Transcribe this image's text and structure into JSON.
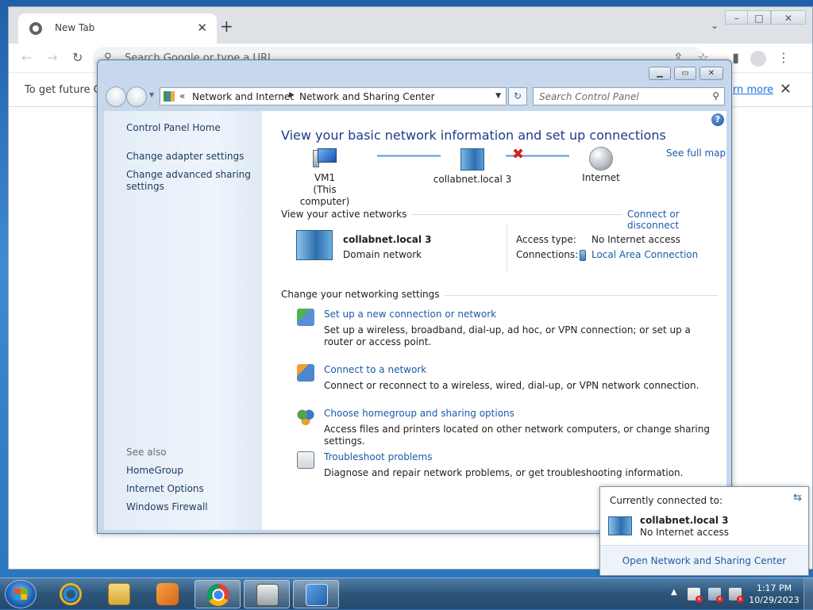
{
  "browser": {
    "tab_title": "New Tab",
    "tab_close_glyph": "✕",
    "new_tab_glyph": "+",
    "omnibox_placeholder": "Search Google or type a URL",
    "infobar_message": "To get future Go",
    "infobar_link": "rn more",
    "infobar_close_glyph": "✕"
  },
  "control_panel": {
    "breadcrumb_chevron": "«",
    "breadcrumb": [
      "Network and Internet",
      "Network and Sharing Center"
    ],
    "search_placeholder": "Search Control Panel",
    "sidebar": {
      "home": "Control Panel Home",
      "links": [
        "Change adapter settings",
        "Change advanced sharing settings"
      ],
      "see_also_title": "See also",
      "see_also": [
        "HomeGroup",
        "Internet Options",
        "Windows Firewall"
      ]
    },
    "main": {
      "title": "View your basic network information and set up connections",
      "see_full_map": "See full map",
      "map": {
        "computer_name": "VM1",
        "computer_sub": "(This computer)",
        "network_name": "collabnet.local  3",
        "internet": "Internet",
        "status_icon": "red-x"
      },
      "active_networks_label": "View your active networks",
      "connect_or_disconnect": "Connect or disconnect",
      "active_network": {
        "name": "collabnet.local  3",
        "category": "Domain network",
        "access_type_label": "Access type:",
        "access_type": "No Internet access",
        "connections_label": "Connections:",
        "connection": "Local Area Connection"
      },
      "settings_label": "Change your networking settings",
      "tasks": [
        {
          "link": "Set up a new connection or network",
          "desc": "Set up a wireless, broadband, dial-up, ad hoc, or VPN connection; or set up a router or access point."
        },
        {
          "link": "Connect to a network",
          "desc": "Connect or reconnect to a wireless, wired, dial-up, or VPN network connection."
        },
        {
          "link": "Choose homegroup and sharing options",
          "desc": "Access files and printers located on other network computers, or change sharing settings."
        },
        {
          "link": "Troubleshoot problems",
          "desc": "Diagnose and repair network problems, or get troubleshooting information."
        }
      ]
    }
  },
  "flyout": {
    "title": "Currently connected to:",
    "network_name": "collabnet.local  3",
    "status": "No Internet access",
    "open_link": "Open Network and Sharing Center"
  },
  "taskbar": {
    "clock_time": "1:17 PM",
    "clock_date": "10/29/2023",
    "tray_up_glyph": "▲",
    "pinned": [
      "internet-explorer",
      "windows-explorer",
      "media-player",
      "google-chrome",
      "printer",
      "control-panel"
    ]
  },
  "colors": {
    "link": "#1c5aa6",
    "title": "#1e3a8a",
    "error_x": "#d81f1f",
    "desktop": "#2c75c0"
  }
}
